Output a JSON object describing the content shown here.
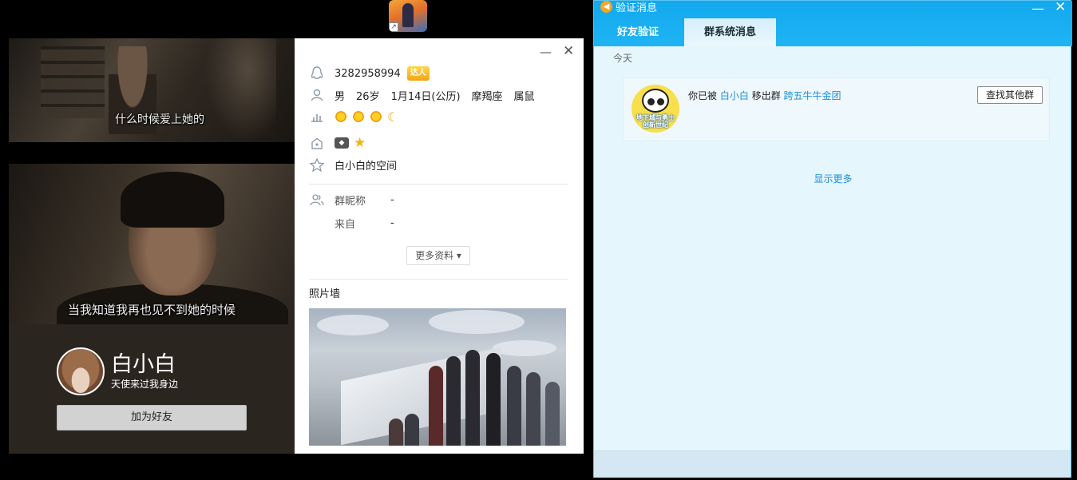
{
  "profile": {
    "caption_top": "什么时候爱上她的",
    "caption_bottom": "当我知道我再也见不到她的时候",
    "nickname": "白小白",
    "signature": "天使来过我身边",
    "add_friend_label": "加为好友",
    "qq_number": "3282958994",
    "badge_label": "达人",
    "gender": "男",
    "age": "26岁",
    "birthday": "1月14日(公历)",
    "constellation": "摩羯座",
    "zodiac": "属鼠",
    "space_label": "白小白的空间",
    "group_nickname_label": "群昵称",
    "group_nickname_value": "-",
    "from_label": "来自",
    "from_value": "-",
    "more_info_label": "更多资料 ▾",
    "photo_wall_label": "照片墙",
    "minimize_glyph": "—",
    "close_glyph": "✕"
  },
  "verify": {
    "title": "验证消息",
    "tabs": [
      "好友验证",
      "群系统消息"
    ],
    "active_tab": "群系统消息",
    "date_header": "今天",
    "message": {
      "prefix": "你已被",
      "user": "白小白",
      "action": "移出群",
      "group": "跨五牛牛金团",
      "avatar_text": "地下城与勇士 创新世纪"
    },
    "find_other_groups_label": "查找其他群",
    "show_more_label": "显示更多",
    "minimize_glyph": "—",
    "close_glyph": "✕"
  },
  "colors": {
    "title_bar": "#12a8ee",
    "link": "#1b8ed8",
    "window_bg": "#e6f6fd"
  }
}
